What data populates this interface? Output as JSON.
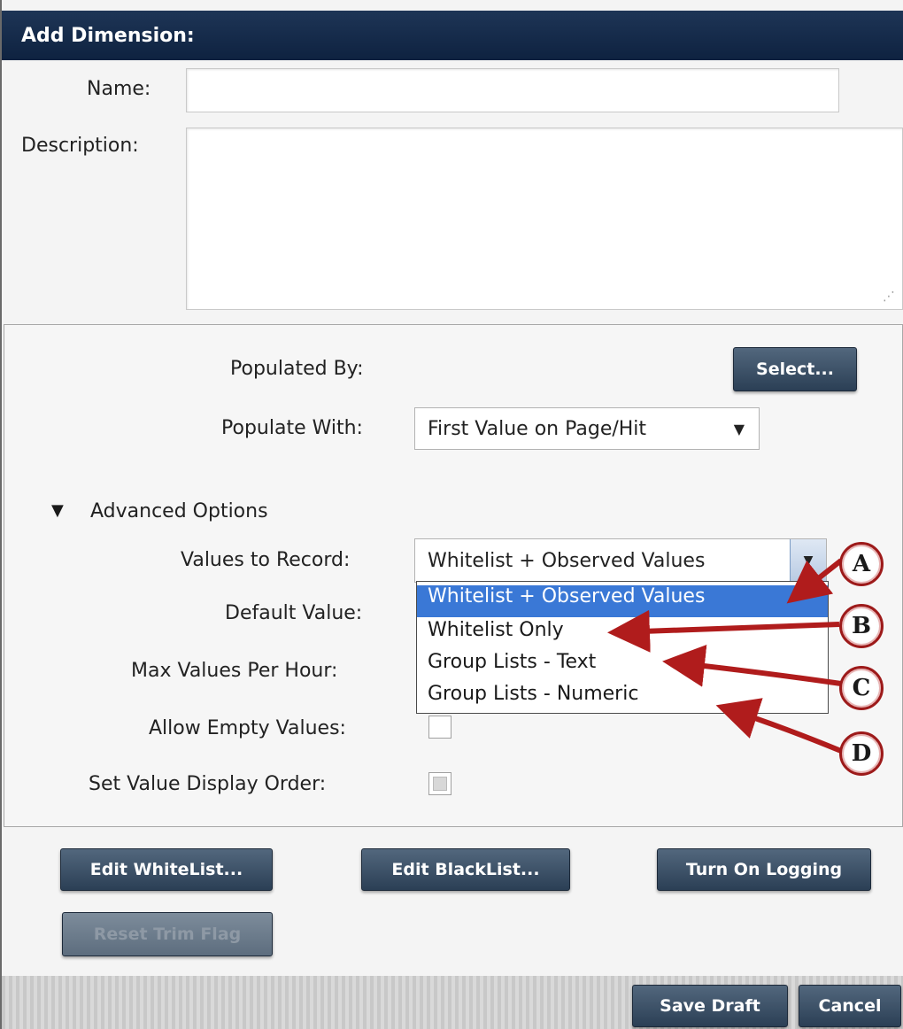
{
  "dialog": {
    "title": "Add Dimension:"
  },
  "form": {
    "name_label": "Name:",
    "name_value": "",
    "description_label": "Description:",
    "description_value": "",
    "resize_grip": "⋰"
  },
  "panel": {
    "populated_by_label": "Populated By:",
    "select_button": "Select...",
    "populate_with_label": "Populate With:",
    "populate_with_value": "First Value on Page/Hit",
    "advanced_options_label": "Advanced Options",
    "values_to_record_label": "Values to Record:",
    "values_to_record_value": "Whitelist + Observed Values",
    "values_to_record_options": [
      "Whitelist + Observed Values",
      "Whitelist Only",
      "Group Lists - Text",
      "Group Lists - Numeric"
    ],
    "default_value_label": "Default Value:",
    "max_values_label": "Max Values Per Hour:",
    "allow_empty_label": "Allow Empty Values:",
    "display_order_label": "Set Value Display Order:"
  },
  "buttons": {
    "edit_whitelist": "Edit WhiteList...",
    "edit_blacklist": "Edit BlackList...",
    "turn_on_logging": "Turn On Logging",
    "reset_trim_flag": "Reset Trim Flag",
    "save_draft": "Save Draft",
    "cancel": "Cancel"
  },
  "callouts": [
    "A",
    "B",
    "C",
    "D"
  ],
  "colors": {
    "title_bar": "#14294a",
    "button": "#3c5169",
    "selected_option": "#3a78d6",
    "arrow": "#b01c1c"
  }
}
